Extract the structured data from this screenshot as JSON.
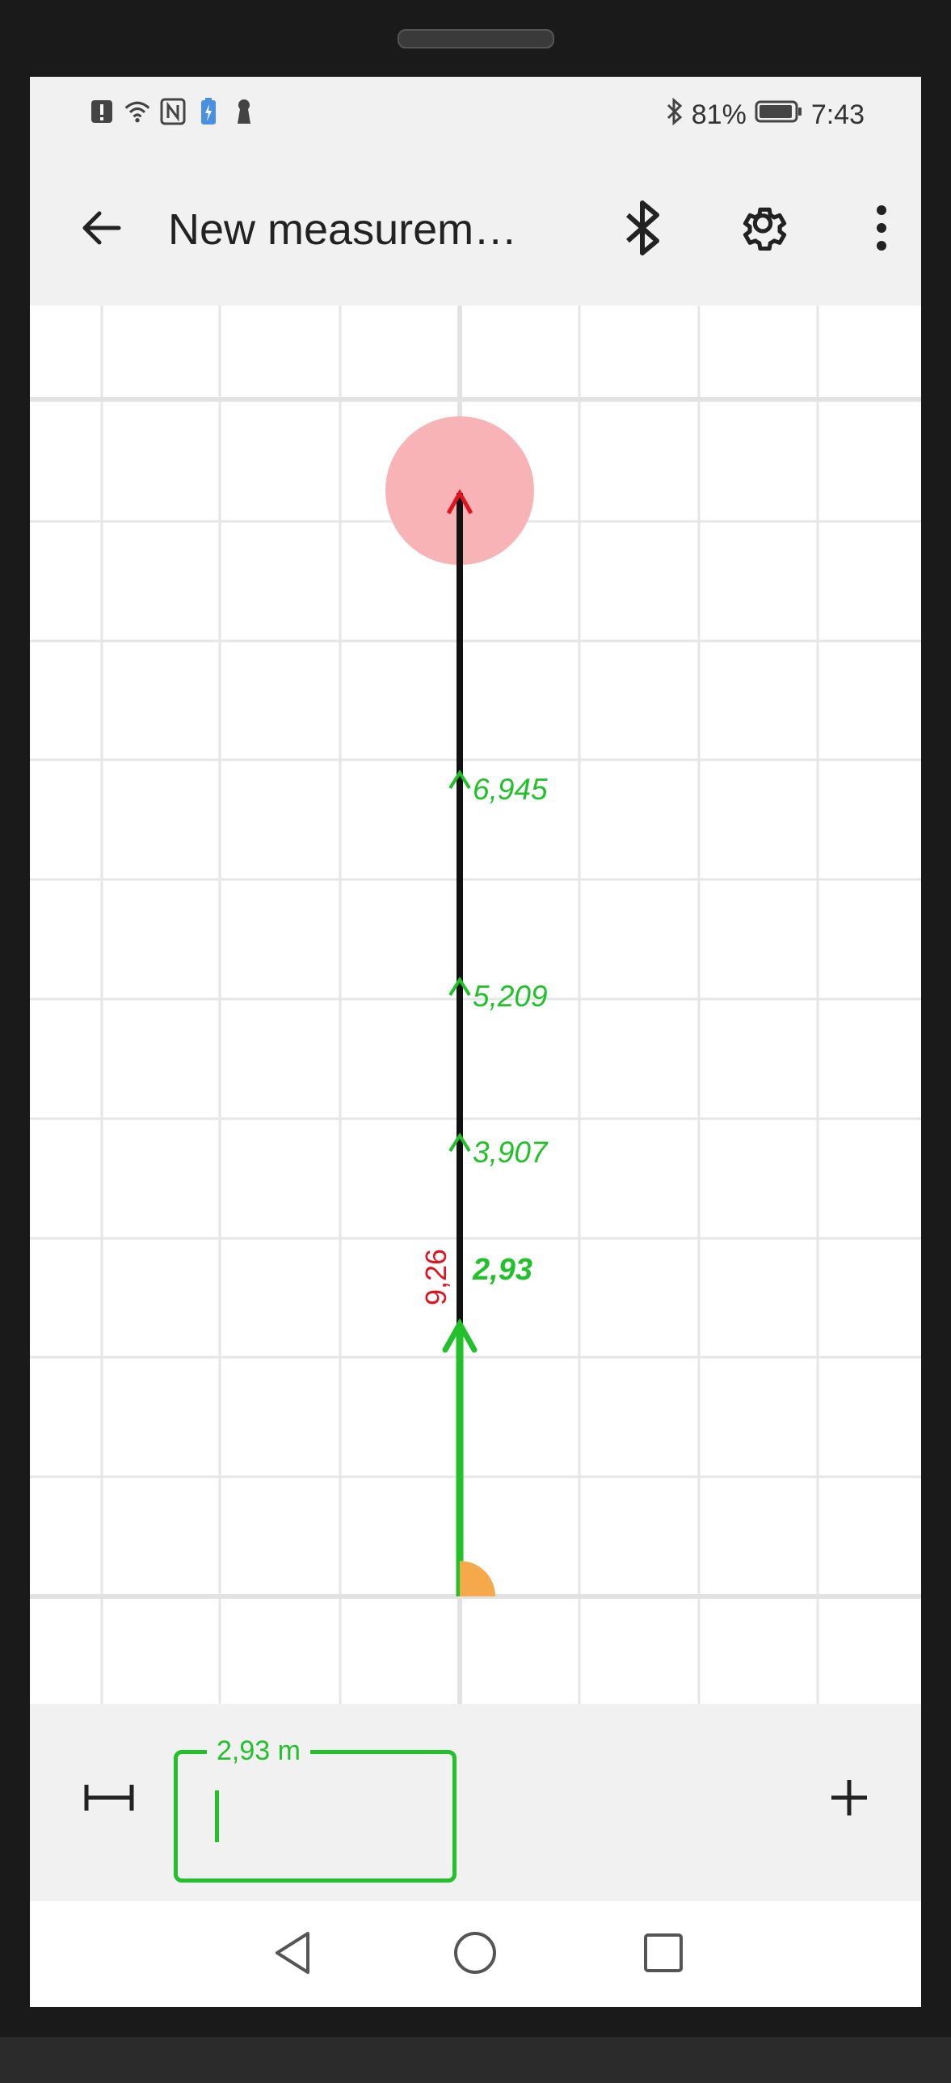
{
  "status_bar": {
    "battery_percent": "81%",
    "time": "7:43",
    "icons": [
      "alert-icon",
      "wifi-icon",
      "nfc-icon",
      "battery-saver-icon",
      "keyhole-icon",
      "bluetooth-icon",
      "battery-icon"
    ]
  },
  "app_bar": {
    "title": "New measurem…",
    "icons": [
      "back-arrow-icon",
      "bluetooth-icon",
      "gear-icon",
      "more-vert-icon"
    ]
  },
  "sketch": {
    "total_length_label": "9,26",
    "segment_label": "2,93",
    "marker_labels": [
      "3,907",
      "5,209",
      "6,945"
    ],
    "colors": {
      "active_segment": "#22c02a",
      "line": "#111111",
      "endpoint_highlight": "#f7b3b6",
      "total_label": "#e0141e",
      "angle_marker": "#f5a94a",
      "grid": "#e6e6e6"
    }
  },
  "bottom_bar": {
    "length_input": {
      "label": "2,93 m",
      "value": "",
      "placeholder": ""
    },
    "icons": [
      "measure-tool-icon",
      "add-icon"
    ]
  },
  "nav_bar": {
    "icons": [
      "nav-back-icon",
      "nav-home-icon",
      "nav-recents-icon"
    ]
  }
}
